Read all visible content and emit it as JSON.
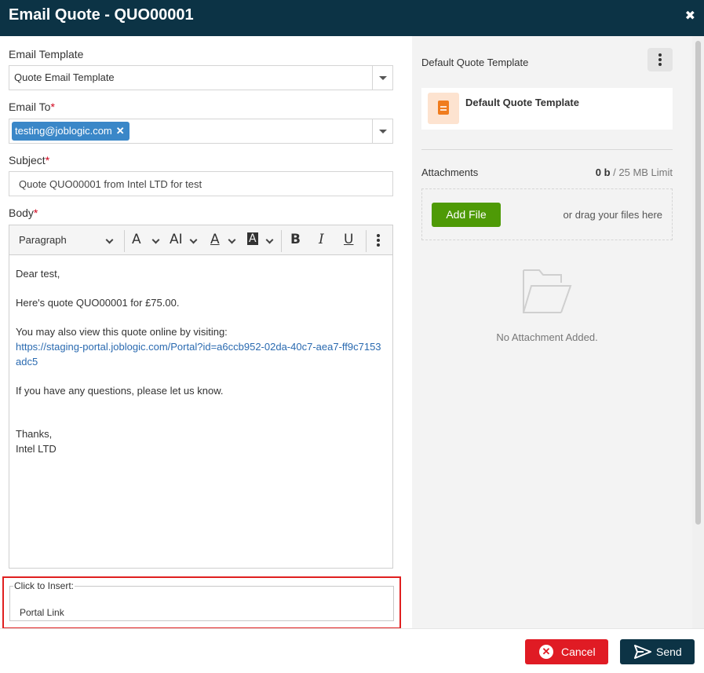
{
  "modal": {
    "title": "Email Quote - QUO00001",
    "close_glyph": "✖"
  },
  "form": {
    "template_label": "Email Template",
    "template_value": "Quote Email Template",
    "email_to_label": "Email To",
    "required_mark": "*",
    "email_to_tags": [
      "testing@joblogic.com"
    ],
    "tag_remove_glyph": "✕",
    "subject_label": "Subject",
    "subject_value": "Quote QUO00001 from Intel LTD for test",
    "body_label": "Body"
  },
  "editor": {
    "toolbar": {
      "paragraph_select": "Paragraph",
      "font_family_icon": "font-family-icon",
      "font_size_icon": "font-size-icon",
      "text_color_icon": "text-color-icon",
      "highlight_icon": "highlight-icon",
      "bold": "B",
      "italic": "I",
      "underline": "U",
      "more_icon": "more-vertical-icon",
      "glyphs": {
        "font_family": "A",
        "font_size": "AI",
        "text_color": "A",
        "highlight": "A"
      }
    },
    "body": {
      "greeting": "Dear test,",
      "line1": "Here's quote QUO00001 for £75.00.",
      "line2": "You may also view this quote online by visiting:",
      "link": "https://staging-portal.joblogic.com/Portal?id=a6ccb952-02da-40c7-aea7-ff9c7153adc5",
      "line3": "If you have any questions, please let us know.",
      "signoff": "Thanks,",
      "company": "Intel LTD"
    }
  },
  "insert": {
    "legend": "Click to Insert:",
    "items": [
      "Portal Link"
    ]
  },
  "sidebar": {
    "template_title": "Default Quote Template",
    "template_file": "Default Quote Template",
    "attachments_label": "Attachments",
    "limit_used": "0 b",
    "limit_total": " / 25 MB Limit",
    "add_file": "Add File",
    "drag_text": "or drag your files here",
    "empty_text": "No Attachment Added."
  },
  "footer": {
    "cancel": "Cancel",
    "send": "Send",
    "cancel_glyph": "✕"
  },
  "colors": {
    "header_bg": "#0c3345",
    "cancel_bg": "#e01b24",
    "send_bg": "#0c3345",
    "add_file_bg": "#4e9a06",
    "tag_bg": "#3a87c8",
    "highlight_border": "#e02020"
  }
}
